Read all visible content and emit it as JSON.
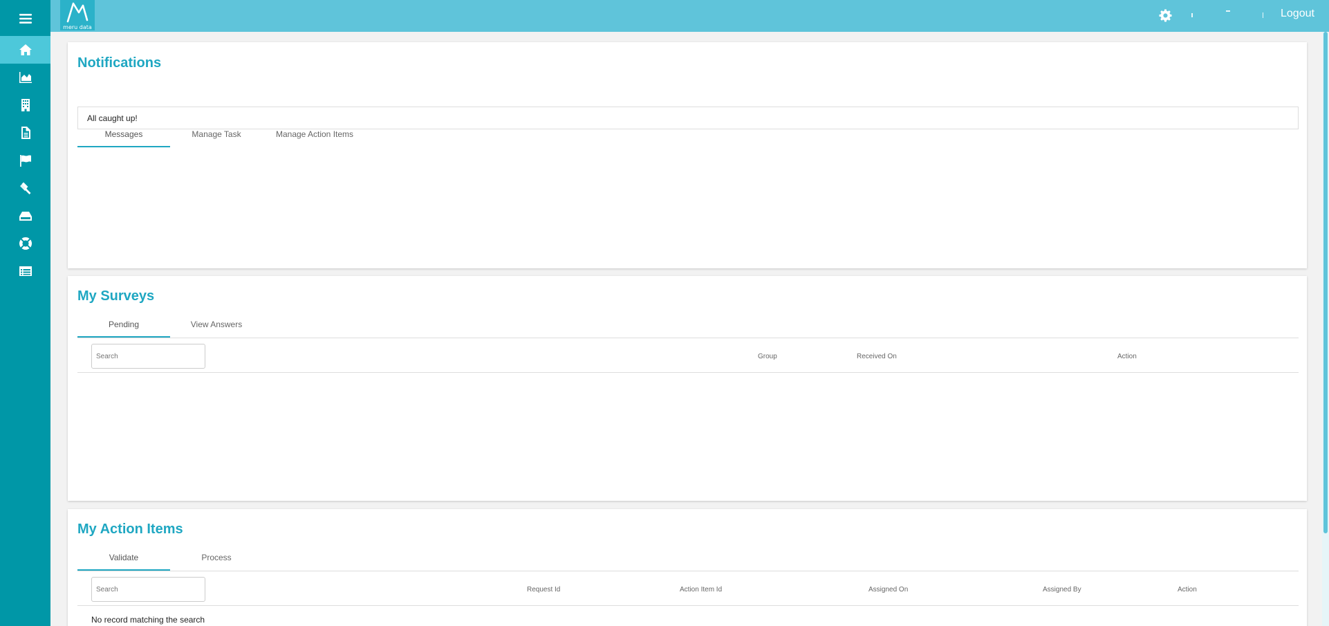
{
  "topbar": {
    "logo_text": "meru data",
    "logout_label": "Logout"
  },
  "sidebar": {
    "items": [
      {
        "icon": "menu-icon"
      },
      {
        "icon": "home-icon"
      },
      {
        "icon": "area-chart-icon"
      },
      {
        "icon": "building-icon"
      },
      {
        "icon": "document-icon"
      },
      {
        "icon": "flag-icon"
      },
      {
        "icon": "gavel-icon"
      },
      {
        "icon": "hard-drive-icon"
      },
      {
        "icon": "life-ring-icon"
      },
      {
        "icon": "list-table-icon"
      }
    ]
  },
  "notifications": {
    "title": "Notifications",
    "tabs": [
      "Messages",
      "Manage Task",
      "Manage Action Items"
    ],
    "message": "All caught up!"
  },
  "surveys": {
    "title": "My Surveys",
    "tabs": [
      "Pending",
      "View Answers"
    ],
    "search_placeholder": "Search",
    "columns": [
      "Group",
      "Received On",
      "Action"
    ]
  },
  "action_items": {
    "title": "My Action Items",
    "tabs": [
      "Validate",
      "Process"
    ],
    "search_placeholder": "Search",
    "columns": [
      "Request Id",
      "Action Item Id",
      "Assigned On",
      "Assigned By",
      "Action"
    ],
    "empty_text": "No record matching the search"
  },
  "colors": {
    "sidebar": "#0097a7",
    "topbar": "#5fc4da",
    "accent": "#1fa7c2"
  }
}
